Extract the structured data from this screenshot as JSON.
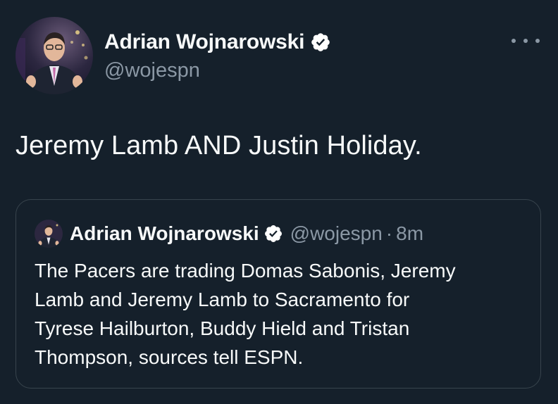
{
  "tweet": {
    "author": {
      "display_name": "Adrian Wojnarowski",
      "handle": "@wojespn",
      "verified": true,
      "avatar_icon": "profile-photo"
    },
    "more_icon": "ellipsis-icon",
    "text": "Jeremy Lamb AND Justin Holiday."
  },
  "quoted_tweet": {
    "author": {
      "display_name": "Adrian Wojnarowski",
      "handle": "@wojespn",
      "verified": true
    },
    "separator": "·",
    "time": "8m",
    "lines": [
      "The Pacers are trading Domas Sabonis, Jeremy",
      "Lamb and Jeremy Lamb to Sacramento for",
      "Tyrese Hailburton, Buddy Hield and Tristan",
      "Thompson, sources tell ESPN."
    ]
  },
  "colors": {
    "background": "#15202b",
    "text_primary": "#f7f9f9",
    "text_secondary": "#8b98a5",
    "border": "#38444d",
    "verified_badge": "#ffffff"
  }
}
